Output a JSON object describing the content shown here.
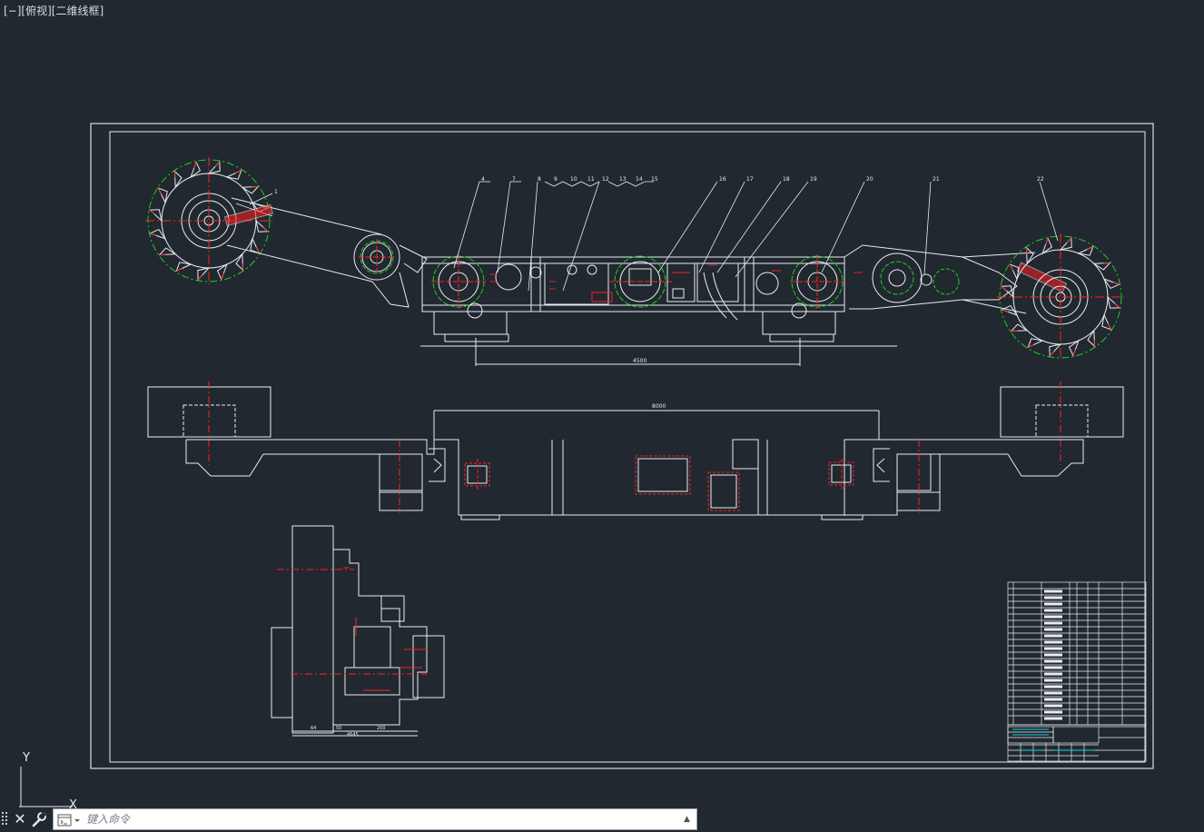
{
  "viewport": {
    "minimize": "[−]",
    "view": "[俯视]",
    "style": "[二维线框]"
  },
  "drawing": {
    "callouts": [
      "4",
      "7",
      "8",
      "9",
      "10",
      "11",
      "12",
      "13",
      "14",
      "15",
      "16",
      "17",
      "18",
      "19",
      "20",
      "21",
      "22",
      "1"
    ],
    "dim_top": "4500",
    "dim_plan": "8000",
    "section_dims": [
      "64",
      "50",
      "200",
      "4645"
    ]
  },
  "ucs": {
    "y_label": "Y",
    "x_label": "X"
  },
  "command_line": {
    "placeholder": "键入命令"
  },
  "colors": {
    "background": "#212830",
    "line": "#e8ecef",
    "center": "#ff2020",
    "pitch": "#22cc22",
    "frame": "#cfe3ec"
  }
}
